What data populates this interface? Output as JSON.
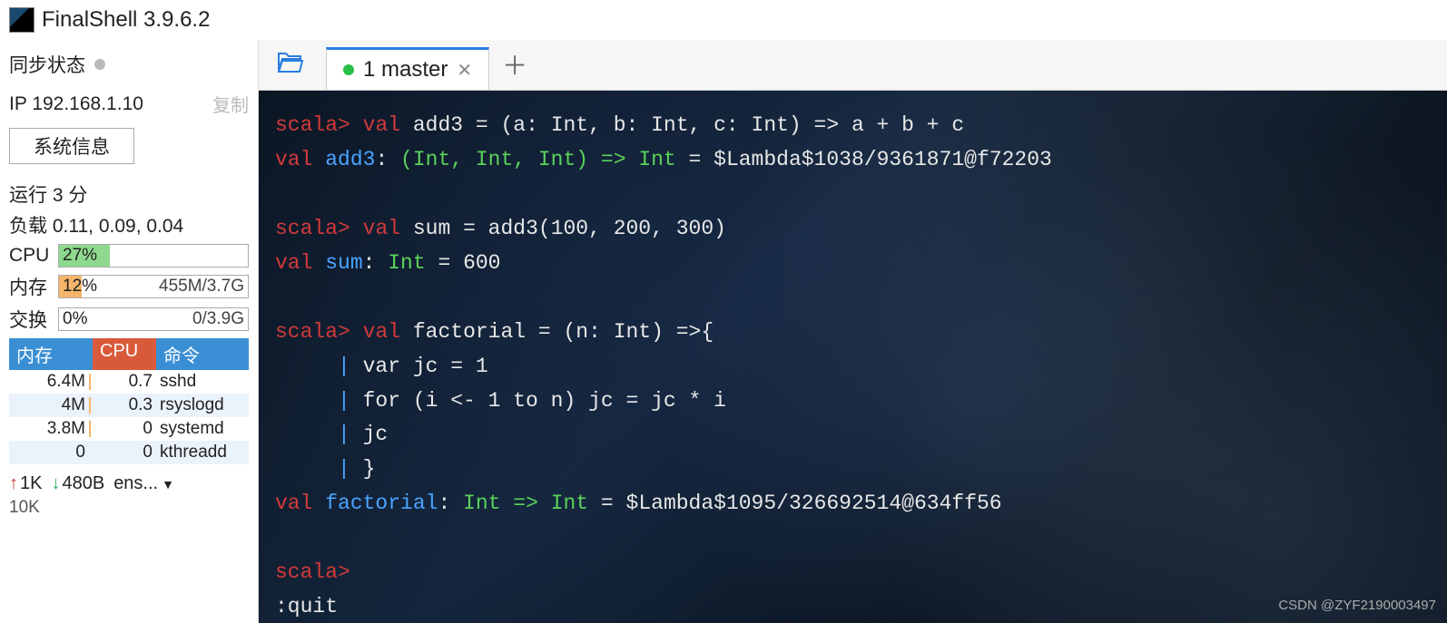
{
  "app": {
    "title": "FinalShell 3.9.6.2"
  },
  "sidebar": {
    "sync_label": "同步状态",
    "ip_label": "IP",
    "ip_value": "192.168.1.10",
    "copy_label": "复制",
    "sysinfo_btn": "系统信息",
    "uptime": "运行 3 分",
    "load": "负载 0.11, 0.09, 0.04",
    "cpu_label": "CPU",
    "cpu_pct": "27%",
    "cpu_fill": 27,
    "mem_label": "内存",
    "mem_pct": "12%",
    "mem_detail": "455M/3.7G",
    "mem_fill": 12,
    "swap_label": "交换",
    "swap_pct": "0%",
    "swap_detail": "0/3.9G",
    "proc_head_mem": "内存",
    "proc_head_cpu": "CPU",
    "proc_head_cmd": "命令",
    "procs": [
      {
        "mem": "6.4M",
        "cpu": "0.7",
        "cmd": "sshd"
      },
      {
        "mem": "4M",
        "cpu": "0.3",
        "cmd": "rsyslogd"
      },
      {
        "mem": "3.8M",
        "cpu": "0",
        "cmd": "systemd"
      },
      {
        "mem": "0",
        "cpu": "0",
        "cmd": "kthreadd"
      }
    ],
    "net_up": "1K",
    "net_down": "480B",
    "net_iface": "ens...",
    "net_scale": "10K"
  },
  "tabs": {
    "active_label": "1 master"
  },
  "terminal": {
    "l1": {
      "prompt": "scala>",
      "kw": "val",
      "rest": " add3 = (a: Int, b: Int, c: Int) => a + b + c"
    },
    "l2": {
      "kw": "val ",
      "id": "add3",
      "colon": ": ",
      "type": "(Int, Int, Int)",
      "arrow": " => ",
      "type2": "Int",
      "rest": " = $Lambda$1038/9361871@f72203"
    },
    "l3": {
      "prompt": "scala>",
      "kw": "val",
      "rest": " sum = add3(100, 200, 300)"
    },
    "l4": {
      "kw": "val ",
      "id": "sum",
      "colon": ": ",
      "type": "Int",
      "rest": " = 600"
    },
    "l5": {
      "prompt": "scala>",
      "kw": "val",
      "rest": " factorial = (n: Int) =>{"
    },
    "l6": {
      "bar": "     | ",
      "rest": "var jc = 1"
    },
    "l7": {
      "bar": "     | ",
      "rest": "for (i <- 1 to n) jc = jc * i"
    },
    "l8": {
      "bar": "     | ",
      "rest": "jc"
    },
    "l9": {
      "bar": "     | ",
      "rest": "}"
    },
    "l10": {
      "kw": "val ",
      "id": "factorial",
      "colon": ": ",
      "type": "Int",
      "arrow": " => ",
      "type2": "Int",
      "rest": " = $Lambda$1095/326692514@634ff56"
    },
    "l11": {
      "prompt": "scala>"
    },
    "l12": {
      "rest": ":quit"
    }
  },
  "watermark": "CSDN @ZYF2190003497"
}
